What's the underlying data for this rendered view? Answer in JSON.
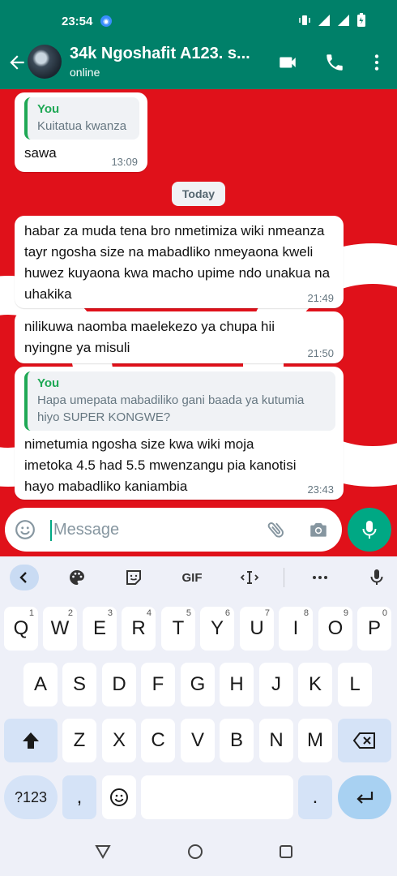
{
  "status_bar": {
    "time": "23:54"
  },
  "header": {
    "contact_name": "34k Ngoshafit A123. s...",
    "status": "online"
  },
  "messages": [
    {
      "quote_author": "You",
      "quote_text": "Kuitatua kwanza",
      "text": "sawa",
      "time": "13:09"
    },
    {
      "text": "habar za muda tena bro nmetimiza wiki nmeanza tayr ngosha size na mabadliko nmeyaona kweli huwez kuyaona kwa macho upime ndo unakua na uhakika",
      "time": "21:49"
    },
    {
      "text": "nilikuwa naomba maelekezo ya chupa hii nyingne ya misuli",
      "time": "21:50"
    },
    {
      "quote_author": "You",
      "quote_text": "Hapa umepata mabadiliko gani baada ya kutumia hiyo SUPER KONGWE?",
      "text": "nimetumia ngosha size kwa wiki moja imetoka 4.5 had 5.5 mwenzangu pia kanotisi hayo mabadliko kaniambia",
      "time": "23:43"
    }
  ],
  "date_chip": "Today",
  "composer": {
    "placeholder": "Message"
  },
  "keyboard": {
    "toolbar": {
      "gif": "GIF"
    },
    "row1": [
      {
        "k": "Q",
        "h": "1"
      },
      {
        "k": "W",
        "h": "2"
      },
      {
        "k": "E",
        "h": "3"
      },
      {
        "k": "R",
        "h": "4"
      },
      {
        "k": "T",
        "h": "5"
      },
      {
        "k": "Y",
        "h": "6"
      },
      {
        "k": "U",
        "h": "7"
      },
      {
        "k": "I",
        "h": "8"
      },
      {
        "k": "O",
        "h": "9"
      },
      {
        "k": "P",
        "h": "0"
      }
    ],
    "row2": [
      "A",
      "S",
      "D",
      "F",
      "G",
      "H",
      "J",
      "K",
      "L"
    ],
    "row3": [
      "Z",
      "X",
      "C",
      "V",
      "B",
      "N",
      "M"
    ],
    "symbols_key": "?123",
    "comma_key": ",",
    "period_key": "."
  },
  "colors": {
    "header": "#008069",
    "chat_background": "#e0111a",
    "accent": "#00a884",
    "quote_author": "#1fa855"
  }
}
